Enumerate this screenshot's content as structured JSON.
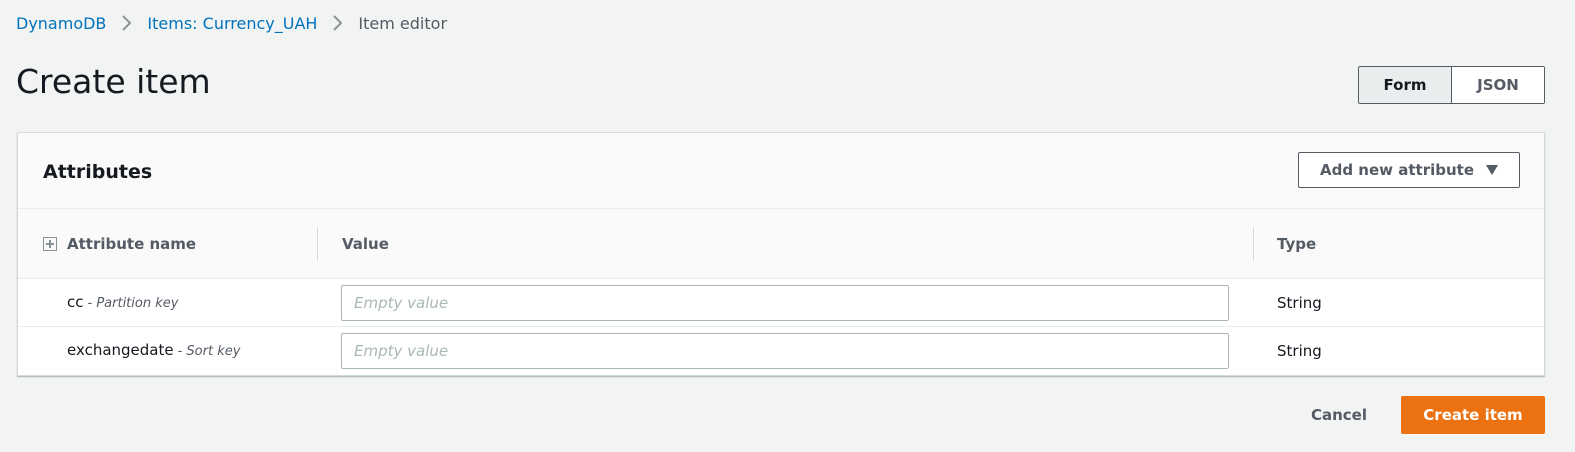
{
  "breadcrumb": {
    "items": [
      {
        "label": "DynamoDB"
      },
      {
        "label": "Items: Currency_UAH"
      },
      {
        "label": "Item editor"
      }
    ]
  },
  "page": {
    "title": "Create item"
  },
  "view_toggle": {
    "form_label": "Form",
    "json_label": "JSON",
    "selected": "Form"
  },
  "attributes_panel": {
    "title": "Attributes",
    "add_button_label": "Add new attribute",
    "columns": {
      "name": "Attribute name",
      "value": "Value",
      "type": "Type"
    },
    "rows": [
      {
        "name": "cc",
        "key_label": "- Partition key",
        "value": "",
        "placeholder": "Empty value",
        "type": "String"
      },
      {
        "name": "exchangedate",
        "key_label": "- Sort key",
        "value": "",
        "placeholder": "Empty value",
        "type": "String"
      }
    ]
  },
  "actions": {
    "cancel_label": "Cancel",
    "create_label": "Create item"
  },
  "colors": {
    "primary": "#ec7211",
    "link": "#0073bb",
    "background": "#f2f3f3"
  },
  "icons": {
    "separator": "chevron-right-icon",
    "dropdown": "caret-down-icon",
    "expand": "expand-plus-icon"
  }
}
